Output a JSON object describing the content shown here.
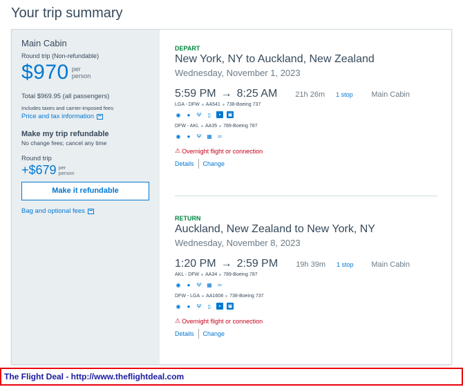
{
  "page": {
    "title": "Your trip summary"
  },
  "sidebar": {
    "cabin": "Main Cabin",
    "trip_type": "Round trip (Non-refundable)",
    "price": "$970",
    "price_per": "per",
    "price_unit": "person",
    "total": "Total $969.95 (all passengers)",
    "taxes_note": "Includes taxes and carrier-imposed fees",
    "price_tax_link": "Price and tax information",
    "refund_title": "Make my trip refundable",
    "refund_sub": "No change fees; cancel any time",
    "round_trip": "Round trip",
    "refund_price": "+$679",
    "refund_per": "per",
    "refund_unit": "person",
    "refund_button": "Make it refundable",
    "bag_link": "Bag and optional fees"
  },
  "depart": {
    "label": "DEPART",
    "route": "New York, NY to Auckland, New Zealand",
    "date": "Wednesday, November 1, 2023",
    "dep_time": "5:59 PM",
    "arrow": "→",
    "arr_time": "8:25 AM",
    "duration": "21h 26m",
    "stops": "1 stop",
    "cabin": "Main Cabin",
    "legs": [
      {
        "route": "LGA - DFW",
        "flight": "AA541",
        "aircraft": "738-Boeing 737",
        "amenities": [
          "wifi-icon",
          "power-icon",
          "usb-icon",
          "phone-icon",
          "entertainment-icon",
          "app-icon"
        ]
      },
      {
        "route": "DFW - AKL",
        "flight": "AA35",
        "aircraft": "789-Boeing 787",
        "amenities": [
          "wifi-icon",
          "power-icon",
          "usb-icon",
          "seatback-screen-icon",
          "lie-flat-icon"
        ]
      }
    ],
    "warning": "Overnight flight or connection",
    "details_link": "Details",
    "change_link": "Change"
  },
  "return": {
    "label": "RETURN",
    "route": "Auckland, New Zealand to New York, NY",
    "date": "Wednesday, November 8, 2023",
    "dep_time": "1:20 PM",
    "arrow": "→",
    "arr_time": "2:59 PM",
    "duration": "19h 39m",
    "stops": "1 stop",
    "cabin": "Main Cabin",
    "legs": [
      {
        "route": "AKL - DFW",
        "flight": "AA34",
        "aircraft": "789-Boeing 787",
        "amenities": [
          "wifi-icon",
          "power-icon",
          "usb-icon",
          "seatback-screen-icon",
          "lie-flat-icon"
        ]
      },
      {
        "route": "DFW - LGA",
        "flight": "AA1608",
        "aircraft": "738-Boeing 737",
        "amenities": [
          "wifi-icon",
          "power-icon",
          "usb-icon",
          "phone-icon",
          "entertainment-icon",
          "app-icon"
        ]
      }
    ],
    "warning": "Overnight flight or connection",
    "details_link": "Details",
    "change_link": "Change"
  },
  "footer": {
    "text": "The Flight Deal - http://www.theflightdeal.com"
  },
  "colors": {
    "accent": "#0078d2",
    "green": "#00853f",
    "warning": "#c30019",
    "footer_border": "#e8000b",
    "footer_text": "#1a1aa0"
  }
}
